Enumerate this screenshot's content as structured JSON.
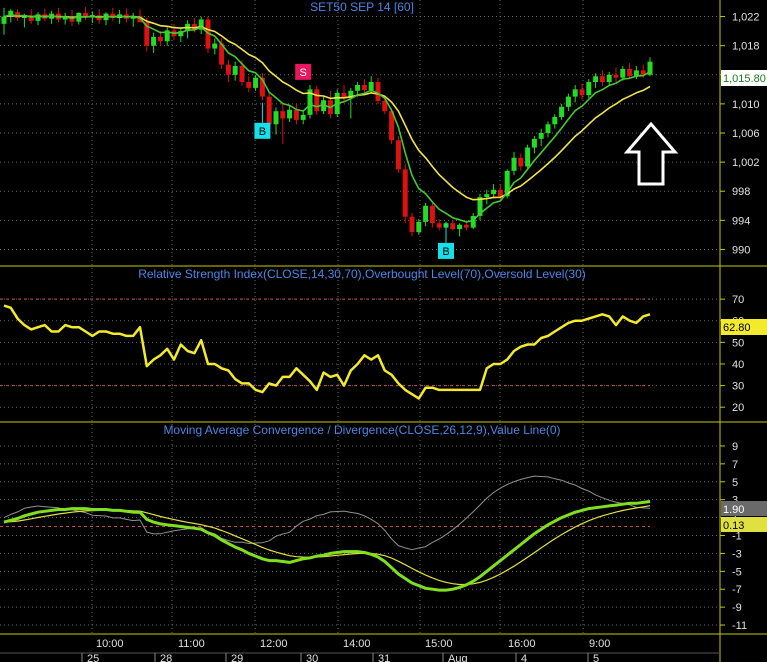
{
  "chart_data": [
    {
      "panel": "price",
      "type": "candlestick",
      "title": "SET50 SEP 14   [60]",
      "ylim": [
        988,
        1024
      ],
      "yticks": [
        990,
        994,
        998,
        1002,
        1006,
        1010,
        1014,
        1018,
        1022
      ],
      "ytick_labels": [
        "990",
        "994",
        "998",
        "1,002",
        "1,006",
        "1,010",
        "1,014",
        "1,018",
        "1,022"
      ],
      "last_price": 1015.8,
      "last_price_label": "1,015.80",
      "candles": [
        [
          1021.0,
          1023.2,
          1019.5,
          1022.0
        ],
        [
          1022.0,
          1023.0,
          1021.2,
          1022.8
        ],
        [
          1022.6,
          1023.0,
          1021.4,
          1021.8
        ],
        [
          1021.8,
          1022.4,
          1020.5,
          1022.2
        ],
        [
          1022.0,
          1023.0,
          1021.0,
          1021.4
        ],
        [
          1021.4,
          1022.6,
          1020.8,
          1022.3
        ],
        [
          1022.3,
          1023.1,
          1021.4,
          1021.7
        ],
        [
          1021.7,
          1022.8,
          1021.0,
          1022.4
        ],
        [
          1022.4,
          1023.2,
          1021.2,
          1021.6
        ],
        [
          1021.6,
          1022.5,
          1020.9,
          1022.0
        ],
        [
          1022.0,
          1022.9,
          1020.7,
          1021.3
        ],
        [
          1021.3,
          1022.6,
          1020.9,
          1022.5
        ],
        [
          1022.5,
          1023.3,
          1021.5,
          1021.9
        ],
        [
          1021.9,
          1022.7,
          1021.1,
          1022.2
        ],
        [
          1022.2,
          1023.0,
          1021.0,
          1021.5
        ],
        [
          1021.5,
          1022.6,
          1020.8,
          1022.4
        ],
        [
          1022.4,
          1023.2,
          1021.4,
          1021.8
        ],
        [
          1021.8,
          1022.9,
          1021.0,
          1022.3
        ],
        [
          1022.3,
          1023.1,
          1021.2,
          1021.7
        ],
        [
          1021.7,
          1022.5,
          1020.6,
          1022.1
        ],
        [
          1022.1,
          1023.0,
          1021.3,
          1021.2
        ],
        [
          1021.2,
          1021.8,
          1017.2,
          1018.0
        ],
        [
          1018.0,
          1019.8,
          1017.0,
          1019.2
        ],
        [
          1019.2,
          1020.0,
          1018.0,
          1018.6
        ],
        [
          1018.6,
          1020.5,
          1018.0,
          1020.1
        ],
        [
          1020.1,
          1021.0,
          1018.8,
          1019.3
        ],
        [
          1019.3,
          1020.4,
          1018.5,
          1020.0
        ],
        [
          1020.0,
          1021.5,
          1019.0,
          1021.0
        ],
        [
          1021.0,
          1021.8,
          1019.8,
          1020.2
        ],
        [
          1020.2,
          1022.0,
          1019.6,
          1021.6
        ],
        [
          1021.6,
          1022.0,
          1017.0,
          1017.6
        ],
        [
          1017.6,
          1019.0,
          1016.8,
          1018.3
        ],
        [
          1018.3,
          1019.0,
          1014.8,
          1015.4
        ],
        [
          1015.4,
          1016.0,
          1013.0,
          1014.0
        ],
        [
          1014.0,
          1015.8,
          1013.2,
          1015.2
        ],
        [
          1015.2,
          1016.0,
          1012.5,
          1013.0
        ],
        [
          1013.0,
          1013.8,
          1011.6,
          1012.2
        ],
        [
          1012.2,
          1014.0,
          1011.8,
          1013.6
        ],
        [
          1013.6,
          1014.2,
          1010.5,
          1011.0
        ],
        [
          1011.0,
          1011.6,
          1006.0,
          1007.2
        ],
        [
          1007.2,
          1009.5,
          1005.8,
          1009.0
        ],
        [
          1009.0,
          1010.0,
          1004.5,
          1008.0
        ],
        [
          1008.0,
          1009.8,
          1007.5,
          1009.2
        ],
        [
          1009.2,
          1010.0,
          1007.2,
          1007.8
        ],
        [
          1007.8,
          1009.0,
          1007.2,
          1008.5
        ],
        [
          1008.5,
          1012.6,
          1008.0,
          1012.0
        ],
        [
          1012.0,
          1012.5,
          1008.5,
          1009.0
        ],
        [
          1009.0,
          1011.0,
          1008.6,
          1010.5
        ],
        [
          1010.5,
          1011.8,
          1008.0,
          1008.6
        ],
        [
          1008.6,
          1012.0,
          1008.2,
          1011.5
        ],
        [
          1011.5,
          1012.6,
          1010.2,
          1010.8
        ],
        [
          1010.8,
          1012.2,
          1008.0,
          1011.8
        ],
        [
          1011.8,
          1013.0,
          1011.0,
          1012.6
        ],
        [
          1012.6,
          1013.4,
          1011.4,
          1011.9
        ],
        [
          1011.9,
          1013.8,
          1011.5,
          1013.0
        ],
        [
          1013.0,
          1013.6,
          1010.0,
          1010.4
        ],
        [
          1010.4,
          1011.0,
          1008.6,
          1009.0
        ],
        [
          1009.0,
          1009.4,
          1004.5,
          1005.0
        ],
        [
          1005.0,
          1005.6,
          1000.5,
          1001.0
        ],
        [
          1001.0,
          1001.8,
          993.6,
          994.5
        ],
        [
          994.5,
          995.0,
          991.8,
          992.4
        ],
        [
          992.4,
          994.2,
          992.0,
          993.8
        ],
        [
          993.8,
          996.4,
          993.2,
          996.0
        ],
        [
          996.0,
          996.6,
          993.0,
          993.6
        ],
        [
          993.6,
          994.2,
          992.6,
          993.0
        ],
        [
          993.0,
          993.8,
          992.4,
          993.6
        ],
        [
          993.6,
          994.0,
          992.6,
          992.8
        ],
        [
          992.8,
          993.6,
          991.8,
          993.4
        ],
        [
          993.4,
          994.0,
          992.6,
          993.0
        ],
        [
          993.0,
          995.0,
          992.8,
          994.6
        ],
        [
          994.6,
          997.6,
          994.0,
          997.2
        ],
        [
          997.2,
          998.2,
          996.2,
          997.6
        ],
        [
          997.6,
          999.0,
          997.0,
          998.2
        ],
        [
          998.2,
          999.0,
          996.8,
          997.3
        ],
        [
          997.3,
          1001.0,
          997.0,
          1000.8
        ],
        [
          1000.8,
          1003.4,
          1000.2,
          1002.6
        ],
        [
          1002.6,
          1003.2,
          1000.8,
          1001.4
        ],
        [
          1001.4,
          1004.4,
          1001.0,
          1004.0
        ],
        [
          1004.0,
          1005.6,
          1003.2,
          1005.2
        ],
        [
          1005.2,
          1006.6,
          1004.2,
          1006.0
        ],
        [
          1006.0,
          1007.6,
          1005.4,
          1007.2
        ],
        [
          1007.2,
          1008.6,
          1006.6,
          1008.2
        ],
        [
          1008.2,
          1010.0,
          1007.8,
          1009.6
        ],
        [
          1009.6,
          1011.4,
          1009.0,
          1011.0
        ],
        [
          1011.0,
          1012.6,
          1010.2,
          1012.0
        ],
        [
          1012.0,
          1012.8,
          1010.6,
          1011.2
        ],
        [
          1011.2,
          1013.4,
          1010.8,
          1013.0
        ],
        [
          1013.0,
          1014.2,
          1012.2,
          1013.8
        ],
        [
          1013.8,
          1014.6,
          1012.4,
          1013.0
        ],
        [
          1013.0,
          1014.4,
          1012.6,
          1014.0
        ],
        [
          1014.0,
          1015.0,
          1013.0,
          1013.6
        ],
        [
          1013.6,
          1015.2,
          1013.2,
          1014.8
        ],
        [
          1014.8,
          1015.6,
          1013.4,
          1013.8
        ],
        [
          1013.8,
          1015.2,
          1013.4,
          1014.6
        ],
        [
          1014.6,
          1015.4,
          1013.6,
          1014.0
        ],
        [
          1014.0,
          1016.4,
          1013.8,
          1015.8
        ]
      ],
      "signals": [
        {
          "text": "S",
          "index": 44,
          "price": 1014.4,
          "color": "#e8185e"
        },
        {
          "text": "B",
          "index": 38,
          "price": 1006.3,
          "color": "#16e0e8"
        },
        {
          "text": "B",
          "index": 65,
          "price": 989.8,
          "color": "#16e0e8"
        }
      ],
      "ma_fast_color": "#46c832",
      "ma_slow_color": "#f0e44a",
      "up_color": "#22dd22",
      "down_color": "#dd1111"
    },
    {
      "panel": "rsi",
      "type": "line",
      "title": "Relative Strength Index(CLOSE,14,30,70),Overbought Level(70),Oversold Level(30)",
      "ylim": [
        15,
        77
      ],
      "yticks": [
        20,
        30,
        40,
        50,
        60,
        70
      ],
      "ytick_labels": [
        "20",
        "30",
        "40",
        "50",
        "60",
        "70"
      ],
      "levels": [
        70,
        30
      ],
      "last_value_label": "62.80",
      "line_color": "#f2ea2a",
      "values": [
        67,
        66,
        61,
        58,
        56,
        57,
        58,
        55,
        55,
        58,
        57,
        57,
        55,
        53,
        55,
        55,
        54,
        54,
        53,
        53,
        57,
        39,
        42,
        44,
        47,
        42,
        49,
        46,
        45,
        51,
        40,
        40,
        38,
        37,
        33,
        31,
        31,
        28,
        27,
        31,
        30,
        34,
        34,
        38,
        35,
        32,
        28,
        36,
        34,
        35,
        30,
        37,
        40,
        44,
        42,
        44,
        37,
        35,
        31,
        28,
        26,
        24,
        29,
        29,
        28,
        28,
        28,
        28,
        28,
        28,
        28,
        38,
        40,
        40,
        42,
        46,
        48,
        49,
        49,
        52,
        53,
        55,
        57,
        59,
        60,
        60,
        61,
        62,
        63,
        62,
        58,
        62,
        60,
        59,
        62,
        63
      ]
    },
    {
      "panel": "macd",
      "type": "line",
      "title": "Moving Average Convergence / Divergence(CLOSE,26,12,9),Value Line(0)",
      "ylim": [
        -12,
        10
      ],
      "yticks": [
        9,
        7,
        5,
        3,
        1,
        -1,
        -3,
        -5,
        -7,
        -9,
        -11
      ],
      "ytick_labels": [
        "9",
        "7",
        "5",
        "3",
        "1",
        "-1",
        "-3",
        "-5",
        "-7",
        "-9",
        "-11"
      ],
      "zero_level": 0,
      "macd_value_label": "1.90",
      "signal_value_label": "0.13",
      "macd_color": "#80e020",
      "signal_color": "#e0e040",
      "hist_color": "#909090",
      "macd": [
        0.5,
        0.7,
        0.9,
        1.2,
        1.4,
        1.6,
        1.7,
        1.8,
        1.9,
        1.9,
        2.0,
        2.0,
        2.0,
        1.9,
        1.9,
        1.9,
        1.8,
        1.8,
        1.7,
        1.6,
        1.6,
        0.8,
        0.5,
        0.3,
        0.2,
        0.1,
        0.0,
        -0.1,
        -0.2,
        -0.3,
        -0.7,
        -1.0,
        -1.5,
        -1.9,
        -2.3,
        -2.6,
        -3.0,
        -3.3,
        -3.6,
        -3.8,
        -3.8,
        -3.9,
        -4.0,
        -3.8,
        -3.6,
        -3.5,
        -3.3,
        -3.2,
        -3.0,
        -2.9,
        -2.8,
        -2.8,
        -2.8,
        -2.9,
        -3.1,
        -3.4,
        -3.9,
        -4.6,
        -5.3,
        -5.8,
        -6.3,
        -6.6,
        -6.9,
        -7.0,
        -7.1,
        -7.1,
        -7.0,
        -6.8,
        -6.5,
        -6.1,
        -5.6,
        -5.0,
        -4.4,
        -3.8,
        -3.2,
        -2.6,
        -2.0,
        -1.4,
        -0.8,
        -0.3,
        0.2,
        0.6,
        1.0,
        1.3,
        1.6,
        1.8,
        2.0,
        2.1,
        2.2,
        2.3,
        2.4,
        2.5,
        2.6,
        2.6,
        2.7,
        2.8
      ]
    }
  ],
  "time_axis": {
    "times": [
      "10:00",
      "11:00",
      "12:00",
      "14:00",
      "15:00",
      "16:00",
      "9:00"
    ],
    "dates": [
      "25",
      "28",
      "29",
      "30",
      "31",
      "Aug",
      "4",
      "5"
    ]
  }
}
